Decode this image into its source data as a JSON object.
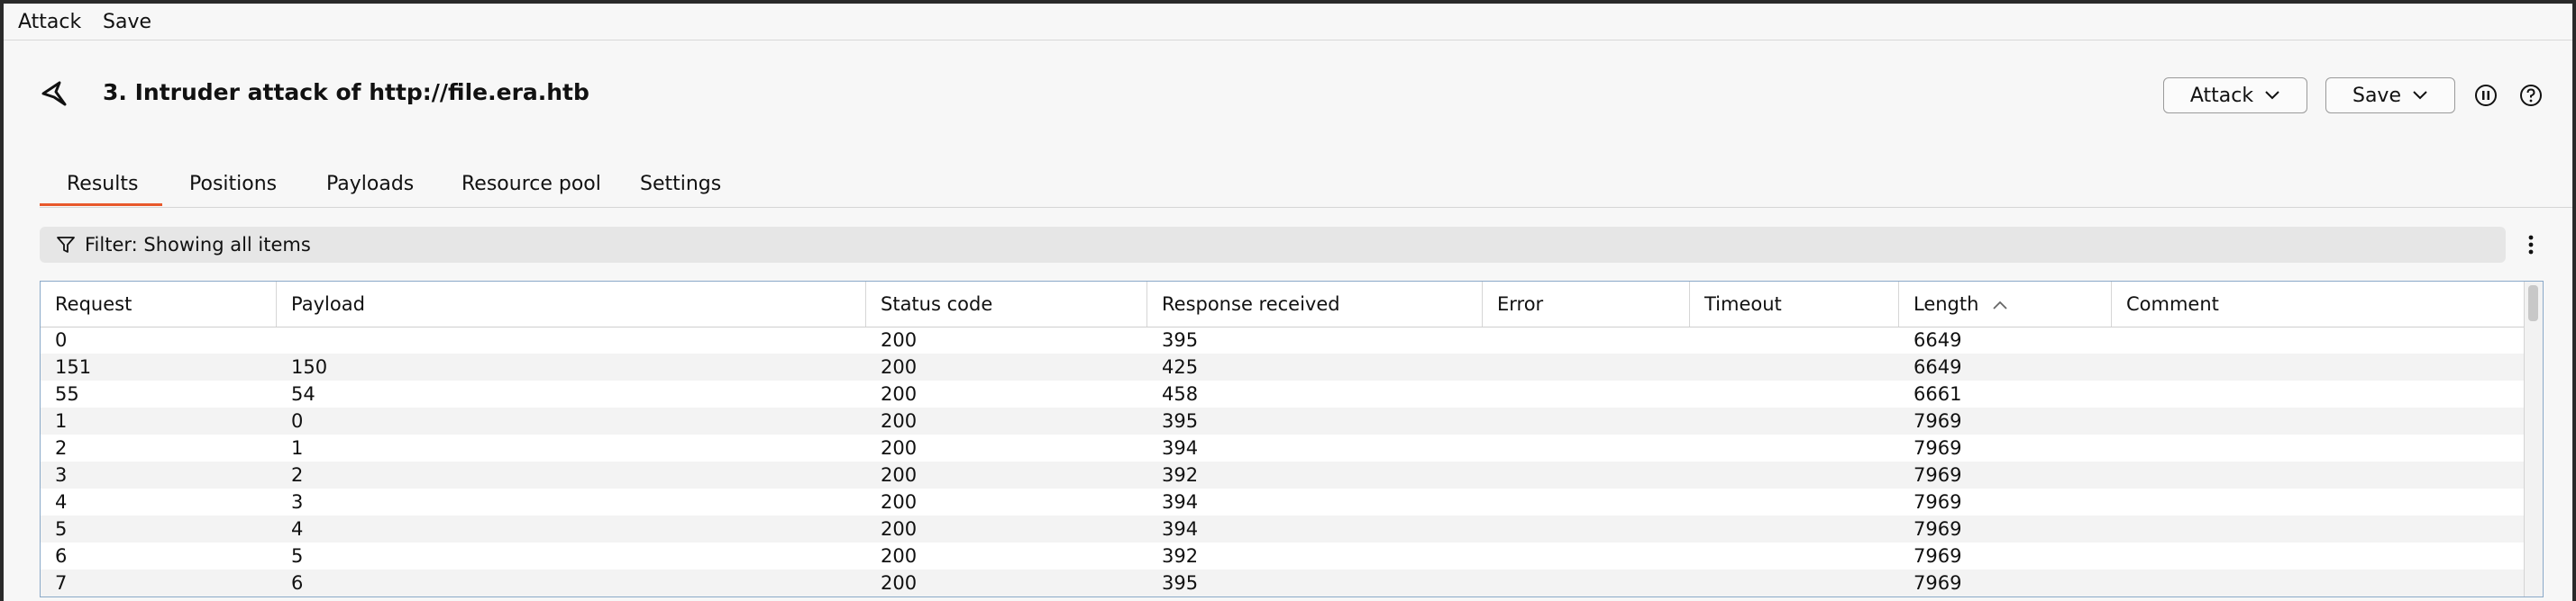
{
  "menubar": {
    "items": [
      "Attack",
      "Save"
    ]
  },
  "header": {
    "title": "3. Intruder attack of http://file.era.htb",
    "attack_button": "Attack",
    "save_button": "Save"
  },
  "tabs": [
    "Results",
    "Positions",
    "Payloads",
    "Resource pool",
    "Settings"
  ],
  "active_tab": "Results",
  "filter": {
    "label": "Filter: Showing all items"
  },
  "table": {
    "columns": [
      "Request",
      "Payload",
      "Status code",
      "Response received",
      "Error",
      "Timeout",
      "Length",
      "Comment"
    ],
    "sorted_column": "Length",
    "rows": [
      [
        "0",
        "",
        "200",
        "395",
        "",
        "",
        "6649",
        ""
      ],
      [
        "151",
        "150",
        "200",
        "425",
        "",
        "",
        "6649",
        ""
      ],
      [
        "55",
        "54",
        "200",
        "458",
        "",
        "",
        "6661",
        ""
      ],
      [
        "1",
        "0",
        "200",
        "395",
        "",
        "",
        "7969",
        ""
      ],
      [
        "2",
        "1",
        "200",
        "394",
        "",
        "",
        "7969",
        ""
      ],
      [
        "3",
        "2",
        "200",
        "392",
        "",
        "",
        "7969",
        ""
      ],
      [
        "4",
        "3",
        "200",
        "394",
        "",
        "",
        "7969",
        ""
      ],
      [
        "5",
        "4",
        "200",
        "394",
        "",
        "",
        "7969",
        ""
      ],
      [
        "6",
        "5",
        "200",
        "392",
        "",
        "",
        "7969",
        ""
      ],
      [
        "7",
        "6",
        "200",
        "395",
        "",
        "",
        "7969",
        ""
      ]
    ]
  },
  "colors": {
    "accent": "#e8582b",
    "table_border": "#8aa9c8"
  }
}
